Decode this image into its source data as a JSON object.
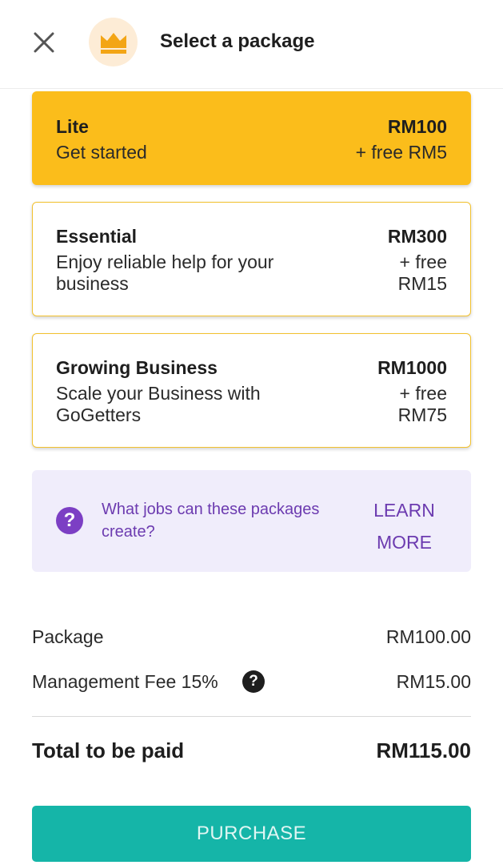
{
  "header": {
    "title": "Select a package",
    "close_icon": "close-icon",
    "badge_icon": "crown-icon"
  },
  "packages": [
    {
      "name": "Lite",
      "description": "Get started",
      "price": "RM100",
      "bonus": "+ free RM5",
      "selected": true
    },
    {
      "name": "Essential",
      "description": "Enjoy reliable help for your business",
      "price": "RM300",
      "bonus": "+ free RM15",
      "selected": false
    },
    {
      "name": "Growing Business",
      "description": "Scale your Business with GoGetters",
      "price": "RM1000",
      "bonus": "+ free RM75",
      "selected": false
    }
  ],
  "info": {
    "question": "What jobs can these packages create?",
    "link": "LEARN MORE",
    "icon": "question-circle-icon"
  },
  "summary": {
    "package_label": "Package",
    "package_value": "RM100.00",
    "fee_label": "Management Fee 15%",
    "fee_value": "RM15.00",
    "total_label": "Total to be paid",
    "total_value": "RM115.00"
  },
  "purchase_label": "PURCHASE",
  "colors": {
    "selected_card": "#fbbd1b",
    "card_border": "#f2c12e",
    "info_bg": "#f0edfb",
    "info_accent": "#7c3fc4",
    "primary_button": "#15b5a8"
  }
}
